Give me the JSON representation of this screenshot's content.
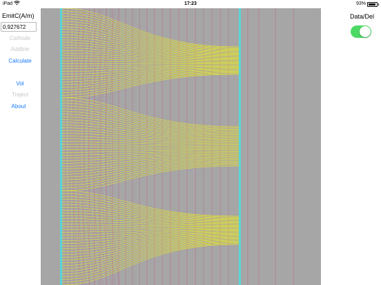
{
  "status_bar": {
    "device": "iPad",
    "time": "17:23",
    "battery": "93%",
    "battery_level": 0.93
  },
  "left_panel": {
    "emit_label": "EmitC(A/m)",
    "emit_value": "0.927672",
    "buttons": {
      "cathode": "Cathode",
      "addline": "Addline",
      "calculate": "Calculate",
      "vol": "Vol",
      "traject": "Traject",
      "about": "About"
    }
  },
  "right_panel": {
    "toggle_label": "Data/Del",
    "toggle_on": true
  },
  "colors": {
    "canvas_bg": "#a6a6a6",
    "electrode": "#58d6d6",
    "trajectory": "#ffff00",
    "equipotential": "#c05a8a",
    "toggle_on": "#4cd964",
    "accent": "#1578ff",
    "disabled": "#c7c7cc"
  }
}
